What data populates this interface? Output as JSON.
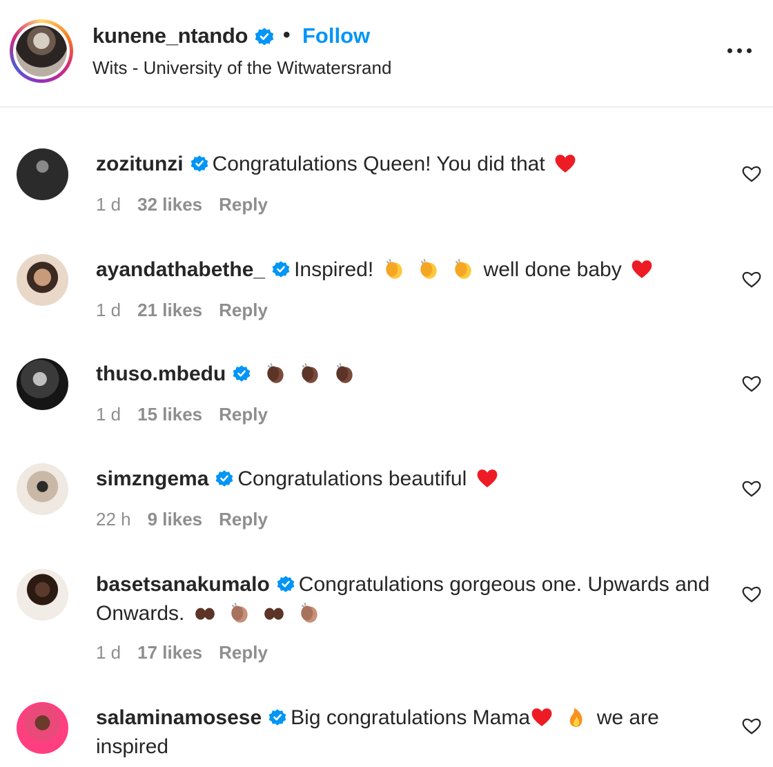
{
  "post_header": {
    "username": "kunene_ntando",
    "separator": "•",
    "follow_label": "Follow",
    "location": "Wits - University of the Witwatersrand",
    "more_icon": "more-horizontal-icon"
  },
  "comments": [
    {
      "username": "zozitunzi",
      "text_parts": [
        "Congratulations Queen! You did that"
      ],
      "emoji": [
        "heart"
      ],
      "time": "1 d",
      "likes": "32 likes",
      "reply": "Reply"
    },
    {
      "username": "ayandathabethe_",
      "text_parts": [
        "Inspired!",
        "well done baby"
      ],
      "emoji": [
        "clap",
        "clap",
        "clap",
        "heart"
      ],
      "time": "1 d",
      "likes": "21 likes",
      "reply": "Reply"
    },
    {
      "username": "thuso.mbedu",
      "text_parts": [],
      "emoji": [
        "clap-dark",
        "clap-dark",
        "clap-dark"
      ],
      "time": "1 d",
      "likes": "15 likes",
      "reply": "Reply"
    },
    {
      "username": "simzngema",
      "text_parts": [
        "Congratulations beautiful"
      ],
      "emoji": [
        "heart"
      ],
      "time": "22 h",
      "likes": "9 likes",
      "reply": "Reply"
    },
    {
      "username": "basetsanakumalo",
      "text_parts": [
        "Congratulations gorgeous one. Upwards and Onwards."
      ],
      "emoji": [
        "eyes-hands",
        "clap-medium",
        "eyes-hands",
        "clap-medium"
      ],
      "time": "1 d",
      "likes": "17 likes",
      "reply": "Reply"
    },
    {
      "username": "salaminamosese",
      "text_parts": [
        "Big congratulations Mama",
        "we are inspired"
      ],
      "emoji": [
        "heart",
        "fire"
      ],
      "time": "",
      "likes": "",
      "reply": ""
    }
  ],
  "colors": {
    "link_blue": "#0095f6",
    "verified_blue": "#0095f6",
    "meta_gray": "#8e8e8e",
    "heart_red": "#ed1c24"
  }
}
